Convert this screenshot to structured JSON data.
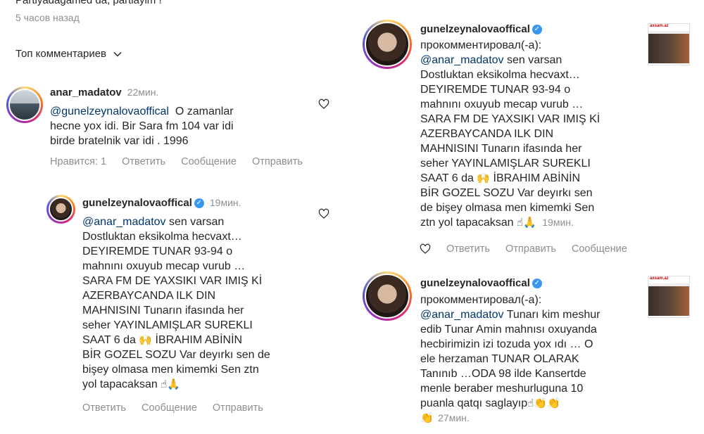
{
  "left": {
    "cut_text": "Partiyadagamed da, partiayim !",
    "time_ago": "5 часов назад",
    "top_comments_label": "Топ комментариев",
    "comment1": {
      "username": "anar_madatov",
      "time": "22мин.",
      "mention": "@gunelzeynalovaoffical",
      "lines": [
        "O zamanlar",
        "hecne yox idi. Bir Sara fm 104 var idi",
        "birde bratelnik var idi . 1996"
      ],
      "actions": [
        "Нравится: 1",
        "Ответить",
        "Сообщение",
        "Отправить"
      ]
    },
    "reply1": {
      "username": "gunelzeynalovaoffical",
      "time": "19мин.",
      "mention": "@anar_madatov",
      "lines": [
        "sen varsan",
        "Dostluktan eksikolma hecvaxt…",
        "DEYIREMDE TUNAR 93-94 o",
        "mahnını oxuyub mecap vurub …",
        "SARA FM DE YAXSIKI VAR IMIŞ Kİ",
        "AZERBAYCANDA ILK DIN",
        "MAHNISINI Tunarın ifasında her",
        "seher YAYINLAMIŞLAR SUREKLI",
        "SAAT 6 da",
        "İBRAHIM ABİNİN",
        "BİR GOZEL SOZU Var deyırkı sen de",
        "bişey olmasa men kimemki Sen ztn",
        "yol tapacaksan"
      ],
      "actions": [
        "Ответить",
        "Сообщение",
        "Отправить"
      ]
    }
  },
  "right": {
    "post1": {
      "username": "gunelzeynalovaoffical",
      "action_text": "прокомментировал(-а):",
      "mention": "@anar_madatov",
      "lines": [
        "sen varsan",
        "Dostluktan eksikolma hecvaxt…",
        "DEYIREMDE TUNAR 93-94 o",
        "mahnını oxuyub mecap vurub …",
        "SARA FM DE YAXSIKI VAR IMIŞ Kİ",
        "AZERBAYCANDA ILK DIN",
        "MAHNISINI Tunarın ifasında her",
        "seher YAYINLAMIŞLAR SUREKLI",
        "SAAT 6 da",
        "İBRAHIM ABİNİN",
        "BİR GOZEL SOZU Var deyırkı sen",
        "de bişey olmasa men kimemki Sen",
        "ztn yol tapacaksan"
      ],
      "time": "19мин.",
      "actions": [
        "Ответить",
        "Отправить",
        "Сообщение"
      ],
      "thumb_brand": "axsam.az"
    },
    "post2": {
      "username": "gunelzeynalovaoffical",
      "action_text": "прокомментировал(-а):",
      "mention": "@anar_madatov",
      "lines": [
        "Tunarı kim meshur",
        "edib Tunar Amin mahnısı oxuyanda",
        "hecbirimizin izi tozuda yox ıdı … O",
        "ele herzaman TUNAR OLARAK",
        "Tanınıb …ODA 98 ilde Kansertde",
        "menle beraber meshurluguna 10",
        "puanla qatqı saglayıp"
      ],
      "time": "27мин.",
      "thumb_brand": "axsam.az"
    }
  },
  "colors": {
    "link": "#00376b",
    "meta": "#8e8e8e",
    "verified": "#3897f0"
  }
}
